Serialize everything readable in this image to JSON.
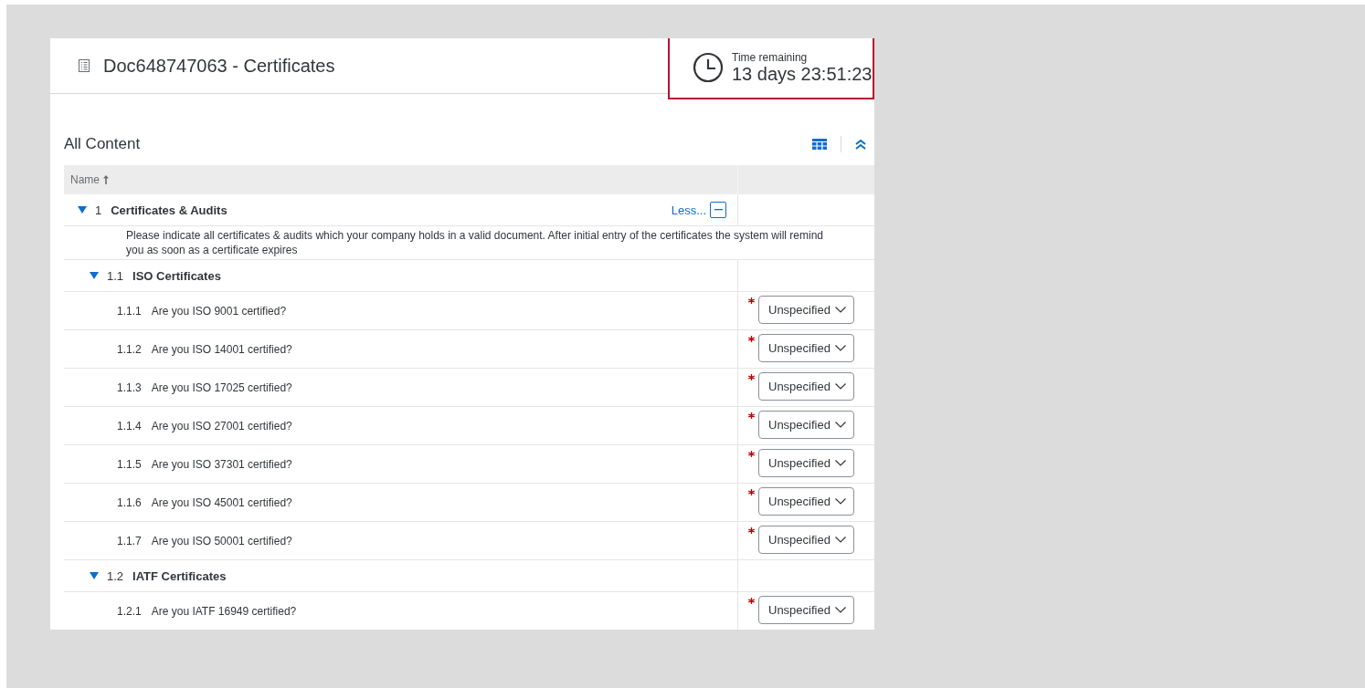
{
  "page": {
    "title": "Doc648747063 - Certificates"
  },
  "timer": {
    "label": "Time remaining",
    "value": "13 days 23:51:23"
  },
  "content": {
    "title": "All Content"
  },
  "table": {
    "columns": [
      {
        "label": "Name",
        "sorted_ascending": true
      }
    ],
    "sections": [
      {
        "number": "1",
        "title": "Certificates & Audits",
        "expanded": true,
        "less_label": "Less...",
        "description": "Please indicate all certificates & audits which your company holds in a valid document. After initial entry of the certificates the system will remind you as soon as a certificate expires",
        "children": [
          {
            "number": "1.1",
            "title": "ISO Certificates",
            "expanded": true,
            "children": [
              {
                "number": "1.1.1",
                "question": "Are you ISO 9001 certified?",
                "required": true,
                "value": "Unspecified"
              },
              {
                "number": "1.1.2",
                "question": "Are you ISO 14001 certified?",
                "required": true,
                "value": "Unspecified"
              },
              {
                "number": "1.1.3",
                "question": "Are you ISO 17025 certified?",
                "required": true,
                "value": "Unspecified"
              },
              {
                "number": "1.1.4",
                "question": "Are you ISO 27001 certified?",
                "required": true,
                "value": "Unspecified"
              },
              {
                "number": "1.1.5",
                "question": "Are you ISO 37301 certified?",
                "required": true,
                "value": "Unspecified"
              },
              {
                "number": "1.1.6",
                "question": "Are you ISO 45001 certified?",
                "required": true,
                "value": "Unspecified"
              },
              {
                "number": "1.1.7",
                "question": "Are you ISO 50001 certified?",
                "required": true,
                "value": "Unspecified"
              }
            ]
          },
          {
            "number": "1.2",
            "title": "IATF Certificates",
            "expanded": true,
            "children": [
              {
                "number": "1.2.1",
                "question": "Are you IATF 16949 certified?",
                "required": true,
                "value": "Unspecified"
              }
            ]
          }
        ]
      }
    ]
  }
}
